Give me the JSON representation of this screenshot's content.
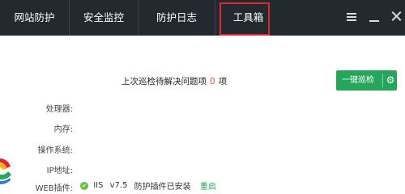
{
  "nav": {
    "tabs": [
      {
        "label": "网站防护"
      },
      {
        "label": "安全监控"
      },
      {
        "label": "防护日志"
      },
      {
        "label": "工具箱",
        "active": true
      }
    ]
  },
  "window_controls": {
    "menu_icon": "hamburger-icon",
    "minimize_icon": "minimize-icon",
    "close_icon": "close-icon"
  },
  "scan": {
    "problems_label": "上次巡检待解决问题项",
    "problems_count": "0",
    "problems_unit": "项",
    "button_label": "一键巡检",
    "settings_icon": "gear-icon"
  },
  "info": {
    "cpu_label": "处理器:",
    "mem_label": "内存:",
    "os_label": "操作系统:",
    "ip_label": "IP地址:",
    "web_label": "WEB插件:",
    "web_server": "IIS",
    "web_version": "v7.5",
    "plugin_status": "防护插件已安装",
    "restart_label": "重启"
  },
  "colors": {
    "topbar": "#22292f",
    "accent_green": "#25a65b",
    "highlight_red": "#e0262c",
    "count_orange": "#e5522d"
  }
}
